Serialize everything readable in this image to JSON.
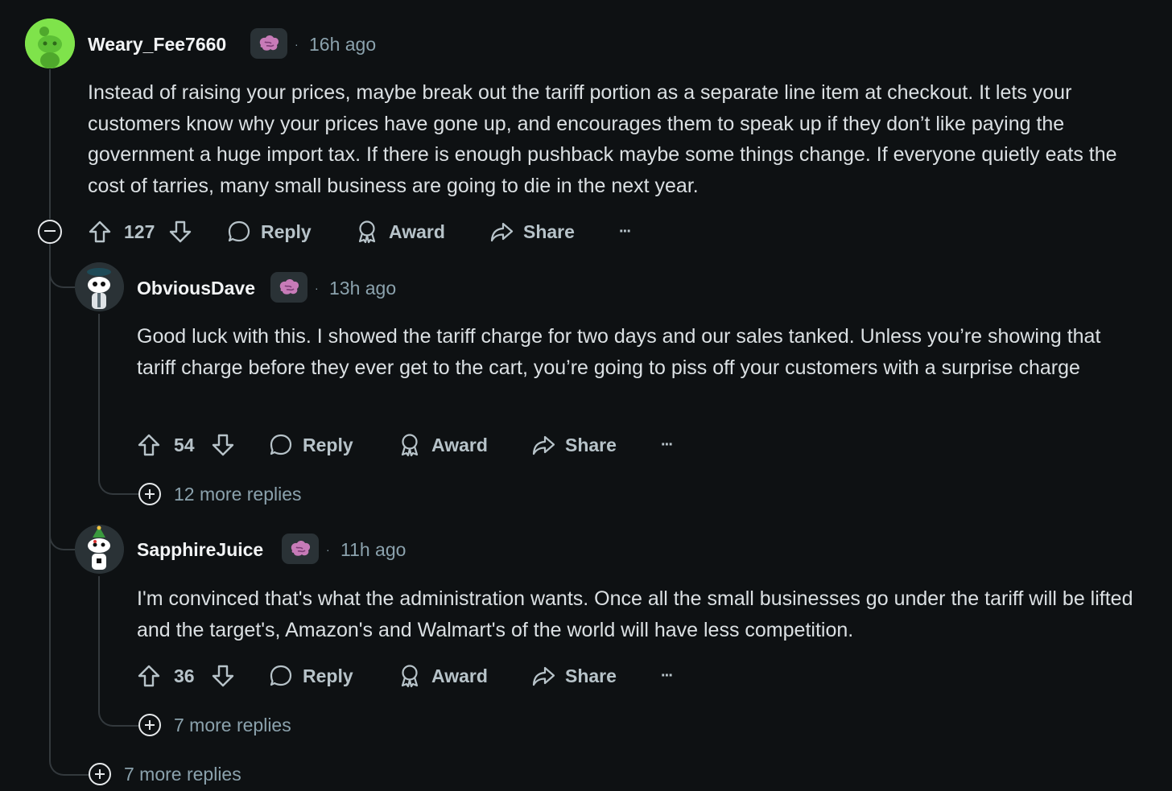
{
  "thread": {
    "top_comment": {
      "username": "Weary_Fee7660",
      "flair_icon": "brain-icon",
      "separator": "·",
      "time": "16h ago",
      "body": "Instead of raising your prices, maybe break out the tariff portion as a separate line item at checkout. It lets your customers know why your prices have gone up, and encourages them to speak up if they don’t like paying the government a huge import tax. If there is enough pushback maybe some things change. If everyone quietly eats the cost of tarries, many small business are going to die in the next year.",
      "votes": "127",
      "reply_label": "Reply",
      "award_label": "Award",
      "share_label": "Share",
      "more_label": "···",
      "avatar_color": "#7fe34b"
    },
    "replies": [
      {
        "username": "ObviousDave",
        "flair_icon": "brain-icon",
        "separator": "·",
        "time": "13h ago",
        "body": "Good luck with this. I showed the tariff charge for two days and our sales tanked. Unless you’re showing that tariff charge before they ever get to the cart, you’re going to piss off your customers with a surprise charge",
        "votes": "54",
        "reply_label": "Reply",
        "award_label": "Award",
        "share_label": "Share",
        "more_label": "···",
        "more_replies": "12 more replies"
      },
      {
        "username": "SapphireJuice",
        "flair_icon": "brain-icon",
        "separator": "·",
        "time": "11h ago",
        "body": "I'm convinced that's what the administration wants. Once all the small businesses go under the tariff will be lifted and the target's, Amazon's and Walmart's of the world will have less competition.",
        "votes": "36",
        "reply_label": "Reply",
        "award_label": "Award",
        "share_label": "Share",
        "more_label": "···",
        "more_replies": "7 more replies"
      }
    ],
    "top_more_replies": "7 more replies"
  }
}
